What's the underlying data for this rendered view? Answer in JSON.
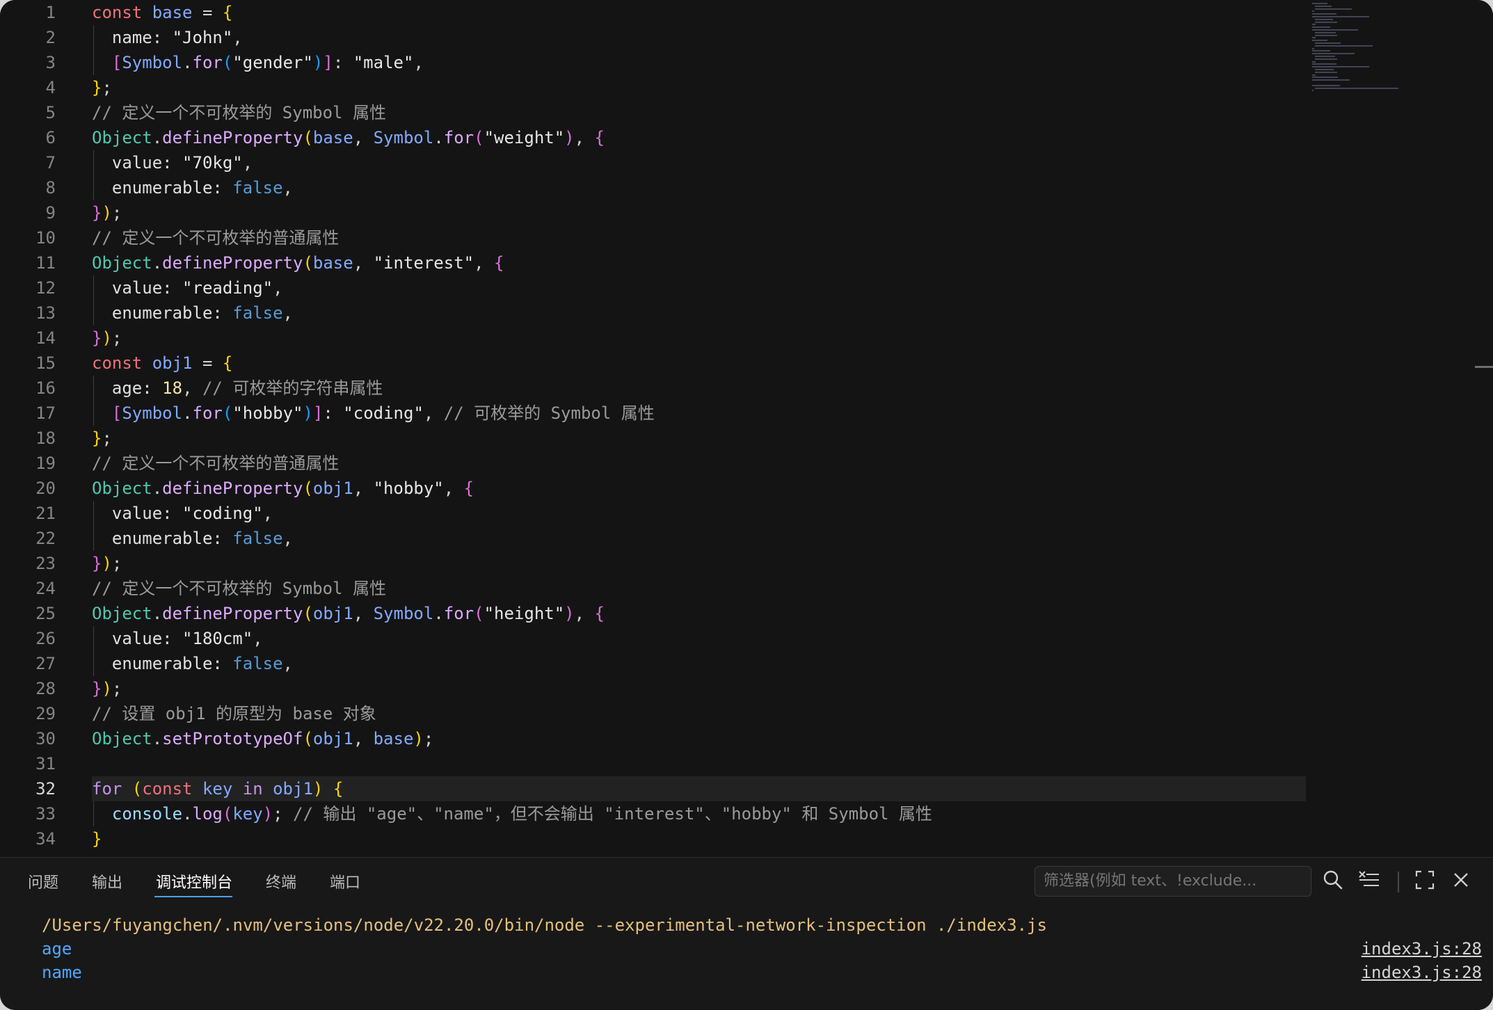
{
  "editor": {
    "current_line": 32,
    "lines": [
      {
        "n": "1",
        "indent": false,
        "tokens": [
          [
            "kw",
            "const "
          ],
          [
            "var",
            "base"
          ],
          [
            "p",
            " = "
          ],
          [
            "b1",
            "{"
          ]
        ]
      },
      {
        "n": "2",
        "indent": true,
        "tokens": [
          [
            "prop",
            "  name: "
          ],
          [
            "str2",
            "\"John\""
          ],
          [
            "p",
            ","
          ]
        ]
      },
      {
        "n": "3",
        "indent": true,
        "tokens": [
          [
            "p",
            "  "
          ],
          [
            "b2",
            "["
          ],
          [
            "var",
            "Symbol"
          ],
          [
            "p",
            "."
          ],
          [
            "fn",
            "for"
          ],
          [
            "b3",
            "("
          ],
          [
            "str2",
            "\"gender\""
          ],
          [
            "b3",
            ")"
          ],
          [
            "b2",
            "]"
          ],
          [
            "p",
            ": "
          ],
          [
            "str2",
            "\"male\""
          ],
          [
            "p",
            ","
          ]
        ]
      },
      {
        "n": "4",
        "indent": false,
        "tokens": [
          [
            "b1",
            "}"
          ],
          [
            "p",
            ";"
          ]
        ]
      },
      {
        "n": "5",
        "indent": false,
        "tokens": [
          [
            "cmt",
            "// 定义一个不可枚举的 Symbol 属性"
          ]
        ]
      },
      {
        "n": "6",
        "indent": false,
        "tokens": [
          [
            "obj",
            "Object"
          ],
          [
            "p",
            "."
          ],
          [
            "fn",
            "defineProperty"
          ],
          [
            "b1",
            "("
          ],
          [
            "var",
            "base"
          ],
          [
            "p",
            ", "
          ],
          [
            "var",
            "Symbol"
          ],
          [
            "p",
            "."
          ],
          [
            "fn",
            "for"
          ],
          [
            "b2",
            "("
          ],
          [
            "str2",
            "\"weight\""
          ],
          [
            "b2",
            ")"
          ],
          [
            "p",
            ", "
          ],
          [
            "b2",
            "{"
          ]
        ]
      },
      {
        "n": "7",
        "indent": true,
        "tokens": [
          [
            "prop",
            "  value: "
          ],
          [
            "str2",
            "\"70kg\""
          ],
          [
            "p",
            ","
          ]
        ]
      },
      {
        "n": "8",
        "indent": true,
        "tokens": [
          [
            "prop",
            "  enumerable: "
          ],
          [
            "bool",
            "false"
          ],
          [
            "p",
            ","
          ]
        ]
      },
      {
        "n": "9",
        "indent": false,
        "tokens": [
          [
            "b2",
            "}"
          ],
          [
            "b1",
            ")"
          ],
          [
            "p",
            ";"
          ]
        ]
      },
      {
        "n": "10",
        "indent": false,
        "tokens": [
          [
            "cmt",
            "// 定义一个不可枚举的普通属性"
          ]
        ]
      },
      {
        "n": "11",
        "indent": false,
        "tokens": [
          [
            "obj",
            "Object"
          ],
          [
            "p",
            "."
          ],
          [
            "fn",
            "defineProperty"
          ],
          [
            "b1",
            "("
          ],
          [
            "var",
            "base"
          ],
          [
            "p",
            ", "
          ],
          [
            "str2",
            "\"interest\""
          ],
          [
            "p",
            ", "
          ],
          [
            "b2",
            "{"
          ]
        ]
      },
      {
        "n": "12",
        "indent": true,
        "tokens": [
          [
            "prop",
            "  value: "
          ],
          [
            "str2",
            "\"reading\""
          ],
          [
            "p",
            ","
          ]
        ]
      },
      {
        "n": "13",
        "indent": true,
        "tokens": [
          [
            "prop",
            "  enumerable: "
          ],
          [
            "bool",
            "false"
          ],
          [
            "p",
            ","
          ]
        ]
      },
      {
        "n": "14",
        "indent": false,
        "tokens": [
          [
            "b2",
            "}"
          ],
          [
            "b1",
            ")"
          ],
          [
            "p",
            ";"
          ]
        ]
      },
      {
        "n": "15",
        "indent": false,
        "tokens": [
          [
            "kw",
            "const "
          ],
          [
            "var",
            "obj1"
          ],
          [
            "p",
            " = "
          ],
          [
            "b1",
            "{"
          ]
        ]
      },
      {
        "n": "16",
        "indent": true,
        "tokens": [
          [
            "prop",
            "  age: "
          ],
          [
            "num",
            "18"
          ],
          [
            "p",
            ", "
          ],
          [
            "cmt",
            "// 可枚举的字符串属性"
          ]
        ]
      },
      {
        "n": "17",
        "indent": true,
        "tokens": [
          [
            "p",
            "  "
          ],
          [
            "b2",
            "["
          ],
          [
            "var",
            "Symbol"
          ],
          [
            "p",
            "."
          ],
          [
            "fn",
            "for"
          ],
          [
            "b3",
            "("
          ],
          [
            "str2",
            "\"hobby\""
          ],
          [
            "b3",
            ")"
          ],
          [
            "b2",
            "]"
          ],
          [
            "p",
            ": "
          ],
          [
            "str2",
            "\"coding\""
          ],
          [
            "p",
            ", "
          ],
          [
            "cmt",
            "// 可枚举的 Symbol 属性"
          ]
        ]
      },
      {
        "n": "18",
        "indent": false,
        "tokens": [
          [
            "b1",
            "}"
          ],
          [
            "p",
            ";"
          ]
        ]
      },
      {
        "n": "19",
        "indent": false,
        "tokens": [
          [
            "cmt",
            "// 定义一个不可枚举的普通属性"
          ]
        ]
      },
      {
        "n": "20",
        "indent": false,
        "tokens": [
          [
            "obj",
            "Object"
          ],
          [
            "p",
            "."
          ],
          [
            "fn",
            "defineProperty"
          ],
          [
            "b1",
            "("
          ],
          [
            "var",
            "obj1"
          ],
          [
            "p",
            ", "
          ],
          [
            "str2",
            "\"hobby\""
          ],
          [
            "p",
            ", "
          ],
          [
            "b2",
            "{"
          ]
        ]
      },
      {
        "n": "21",
        "indent": true,
        "tokens": [
          [
            "prop",
            "  value: "
          ],
          [
            "str2",
            "\"coding\""
          ],
          [
            "p",
            ","
          ]
        ]
      },
      {
        "n": "22",
        "indent": true,
        "tokens": [
          [
            "prop",
            "  enumerable: "
          ],
          [
            "bool",
            "false"
          ],
          [
            "p",
            ","
          ]
        ]
      },
      {
        "n": "23",
        "indent": false,
        "tokens": [
          [
            "b2",
            "}"
          ],
          [
            "b1",
            ")"
          ],
          [
            "p",
            ";"
          ]
        ]
      },
      {
        "n": "24",
        "indent": false,
        "tokens": [
          [
            "cmt",
            "// 定义一个不可枚举的 Symbol 属性"
          ]
        ]
      },
      {
        "n": "25",
        "indent": false,
        "tokens": [
          [
            "obj",
            "Object"
          ],
          [
            "p",
            "."
          ],
          [
            "fn",
            "defineProperty"
          ],
          [
            "b1",
            "("
          ],
          [
            "var",
            "obj1"
          ],
          [
            "p",
            ", "
          ],
          [
            "var",
            "Symbol"
          ],
          [
            "p",
            "."
          ],
          [
            "fn",
            "for"
          ],
          [
            "b2",
            "("
          ],
          [
            "str2",
            "\"height\""
          ],
          [
            "b2",
            ")"
          ],
          [
            "p",
            ", "
          ],
          [
            "b2",
            "{"
          ]
        ]
      },
      {
        "n": "26",
        "indent": true,
        "tokens": [
          [
            "prop",
            "  value: "
          ],
          [
            "str2",
            "\"180cm\""
          ],
          [
            "p",
            ","
          ]
        ]
      },
      {
        "n": "27",
        "indent": true,
        "tokens": [
          [
            "prop",
            "  enumerable: "
          ],
          [
            "bool",
            "false"
          ],
          [
            "p",
            ","
          ]
        ]
      },
      {
        "n": "28",
        "indent": false,
        "tokens": [
          [
            "b2",
            "}"
          ],
          [
            "b1",
            ")"
          ],
          [
            "p",
            ";"
          ]
        ]
      },
      {
        "n": "29",
        "indent": false,
        "tokens": [
          [
            "cmt",
            "// 设置 obj1 的原型为 base 对象"
          ]
        ]
      },
      {
        "n": "30",
        "indent": false,
        "tokens": [
          [
            "obj",
            "Object"
          ],
          [
            "p",
            "."
          ],
          [
            "fn",
            "setPrototypeOf"
          ],
          [
            "b1",
            "("
          ],
          [
            "var",
            "obj1"
          ],
          [
            "p",
            ", "
          ],
          [
            "var",
            "base"
          ],
          [
            "b1",
            ")"
          ],
          [
            "p",
            ";"
          ]
        ]
      },
      {
        "n": "31",
        "indent": false,
        "tokens": []
      },
      {
        "n": "32",
        "indent": false,
        "tokens": [
          [
            "kw2",
            "for "
          ],
          [
            "b1",
            "("
          ],
          [
            "kw",
            "const "
          ],
          [
            "var",
            "key "
          ],
          [
            "kw2",
            "in "
          ],
          [
            "var",
            "obj1"
          ],
          [
            "b1",
            ")"
          ],
          [
            "p",
            " "
          ],
          [
            "b1",
            "{"
          ]
        ]
      },
      {
        "n": "33",
        "indent": true,
        "tokens": [
          [
            "p",
            "  "
          ],
          [
            "con",
            "console"
          ],
          [
            "p",
            "."
          ],
          [
            "fn",
            "log"
          ],
          [
            "b2",
            "("
          ],
          [
            "var",
            "key"
          ],
          [
            "b2",
            ")"
          ],
          [
            "p",
            "; "
          ],
          [
            "cmt",
            "// 输出 \"age\"、\"name\"，但不会输出 \"interest\"、\"hobby\" 和 Symbol 属性"
          ]
        ]
      },
      {
        "n": "34",
        "indent": false,
        "tokens": [
          [
            "b1",
            "}"
          ]
        ]
      }
    ]
  },
  "panel": {
    "tabs": [
      {
        "label": "问题",
        "active": false
      },
      {
        "label": "输出",
        "active": false
      },
      {
        "label": "调试控制台",
        "active": true
      },
      {
        "label": "终端",
        "active": false
      },
      {
        "label": "端口",
        "active": false
      }
    ],
    "filter_placeholder": "筛选器(例如 text、!exclude...",
    "icons": [
      "search-icon",
      "clear-console-icon",
      "maximize-icon",
      "close-icon"
    ],
    "output": [
      {
        "text": "/Users/fuyangchen/.nvm/versions/node/v22.20.0/bin/node --experimental-network-inspection ./index3.js",
        "kind": "cmd",
        "source": ""
      },
      {
        "text": "age",
        "kind": "log",
        "source": "index3.js:28"
      },
      {
        "text": "name",
        "kind": "log",
        "source": "index3.js:28"
      }
    ]
  }
}
